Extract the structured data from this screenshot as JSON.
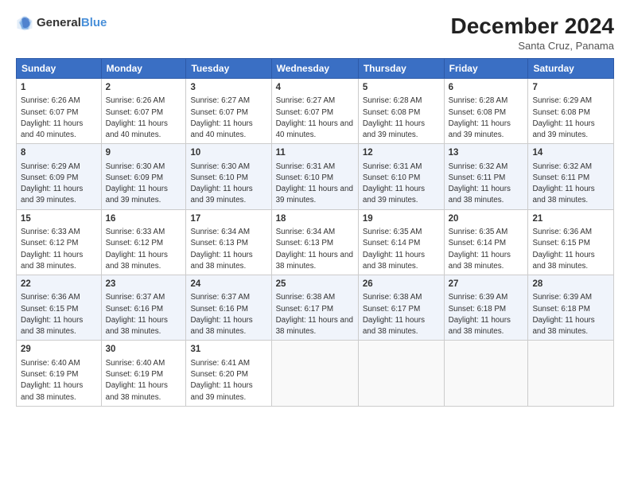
{
  "logo": {
    "text_general": "General",
    "text_blue": "Blue"
  },
  "header": {
    "month_year": "December 2024",
    "location": "Santa Cruz, Panama"
  },
  "days_of_week": [
    "Sunday",
    "Monday",
    "Tuesday",
    "Wednesday",
    "Thursday",
    "Friday",
    "Saturday"
  ],
  "weeks": [
    [
      {
        "day": "1",
        "sunrise": "6:26 AM",
        "sunset": "6:07 PM",
        "daylight": "11 hours and 40 minutes."
      },
      {
        "day": "2",
        "sunrise": "6:26 AM",
        "sunset": "6:07 PM",
        "daylight": "11 hours and 40 minutes."
      },
      {
        "day": "3",
        "sunrise": "6:27 AM",
        "sunset": "6:07 PM",
        "daylight": "11 hours and 40 minutes."
      },
      {
        "day": "4",
        "sunrise": "6:27 AM",
        "sunset": "6:07 PM",
        "daylight": "11 hours and 40 minutes."
      },
      {
        "day": "5",
        "sunrise": "6:28 AM",
        "sunset": "6:08 PM",
        "daylight": "11 hours and 39 minutes."
      },
      {
        "day": "6",
        "sunrise": "6:28 AM",
        "sunset": "6:08 PM",
        "daylight": "11 hours and 39 minutes."
      },
      {
        "day": "7",
        "sunrise": "6:29 AM",
        "sunset": "6:08 PM",
        "daylight": "11 hours and 39 minutes."
      }
    ],
    [
      {
        "day": "8",
        "sunrise": "6:29 AM",
        "sunset": "6:09 PM",
        "daylight": "11 hours and 39 minutes."
      },
      {
        "day": "9",
        "sunrise": "6:30 AM",
        "sunset": "6:09 PM",
        "daylight": "11 hours and 39 minutes."
      },
      {
        "day": "10",
        "sunrise": "6:30 AM",
        "sunset": "6:10 PM",
        "daylight": "11 hours and 39 minutes."
      },
      {
        "day": "11",
        "sunrise": "6:31 AM",
        "sunset": "6:10 PM",
        "daylight": "11 hours and 39 minutes."
      },
      {
        "day": "12",
        "sunrise": "6:31 AM",
        "sunset": "6:10 PM",
        "daylight": "11 hours and 39 minutes."
      },
      {
        "day": "13",
        "sunrise": "6:32 AM",
        "sunset": "6:11 PM",
        "daylight": "11 hours and 38 minutes."
      },
      {
        "day": "14",
        "sunrise": "6:32 AM",
        "sunset": "6:11 PM",
        "daylight": "11 hours and 38 minutes."
      }
    ],
    [
      {
        "day": "15",
        "sunrise": "6:33 AM",
        "sunset": "6:12 PM",
        "daylight": "11 hours and 38 minutes."
      },
      {
        "day": "16",
        "sunrise": "6:33 AM",
        "sunset": "6:12 PM",
        "daylight": "11 hours and 38 minutes."
      },
      {
        "day": "17",
        "sunrise": "6:34 AM",
        "sunset": "6:13 PM",
        "daylight": "11 hours and 38 minutes."
      },
      {
        "day": "18",
        "sunrise": "6:34 AM",
        "sunset": "6:13 PM",
        "daylight": "11 hours and 38 minutes."
      },
      {
        "day": "19",
        "sunrise": "6:35 AM",
        "sunset": "6:14 PM",
        "daylight": "11 hours and 38 minutes."
      },
      {
        "day": "20",
        "sunrise": "6:35 AM",
        "sunset": "6:14 PM",
        "daylight": "11 hours and 38 minutes."
      },
      {
        "day": "21",
        "sunrise": "6:36 AM",
        "sunset": "6:15 PM",
        "daylight": "11 hours and 38 minutes."
      }
    ],
    [
      {
        "day": "22",
        "sunrise": "6:36 AM",
        "sunset": "6:15 PM",
        "daylight": "11 hours and 38 minutes."
      },
      {
        "day": "23",
        "sunrise": "6:37 AM",
        "sunset": "6:16 PM",
        "daylight": "11 hours and 38 minutes."
      },
      {
        "day": "24",
        "sunrise": "6:37 AM",
        "sunset": "6:16 PM",
        "daylight": "11 hours and 38 minutes."
      },
      {
        "day": "25",
        "sunrise": "6:38 AM",
        "sunset": "6:17 PM",
        "daylight": "11 hours and 38 minutes."
      },
      {
        "day": "26",
        "sunrise": "6:38 AM",
        "sunset": "6:17 PM",
        "daylight": "11 hours and 38 minutes."
      },
      {
        "day": "27",
        "sunrise": "6:39 AM",
        "sunset": "6:18 PM",
        "daylight": "11 hours and 38 minutes."
      },
      {
        "day": "28",
        "sunrise": "6:39 AM",
        "sunset": "6:18 PM",
        "daylight": "11 hours and 38 minutes."
      }
    ],
    [
      {
        "day": "29",
        "sunrise": "6:40 AM",
        "sunset": "6:19 PM",
        "daylight": "11 hours and 38 minutes."
      },
      {
        "day": "30",
        "sunrise": "6:40 AM",
        "sunset": "6:19 PM",
        "daylight": "11 hours and 38 minutes."
      },
      {
        "day": "31",
        "sunrise": "6:41 AM",
        "sunset": "6:20 PM",
        "daylight": "11 hours and 39 minutes."
      },
      null,
      null,
      null,
      null
    ]
  ]
}
